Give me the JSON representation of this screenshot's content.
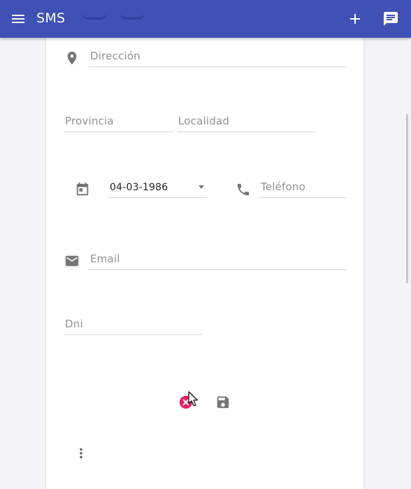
{
  "app": {
    "title": "SMS"
  },
  "form": {
    "direccion_placeholder": "Dirección",
    "provincia_placeholder": "Provincia",
    "localidad_placeholder": "Localidad",
    "fecha_value": "04-03-1986",
    "telefono_placeholder": "Teléfono",
    "email_placeholder": "Email",
    "dni_placeholder": "Dni"
  },
  "icons": {
    "menu": "menu-icon",
    "add": "add-icon",
    "message": "message-icon",
    "location": "location-pin-icon",
    "calendar": "calendar-icon",
    "phone": "phone-icon",
    "email": "email-icon",
    "cancel": "cancel-icon",
    "save": "save-icon",
    "more": "more-vert-icon"
  },
  "colors": {
    "primary": "#3f51b5",
    "cancel_accent": "#e91e63",
    "icon_gray": "#757575"
  }
}
